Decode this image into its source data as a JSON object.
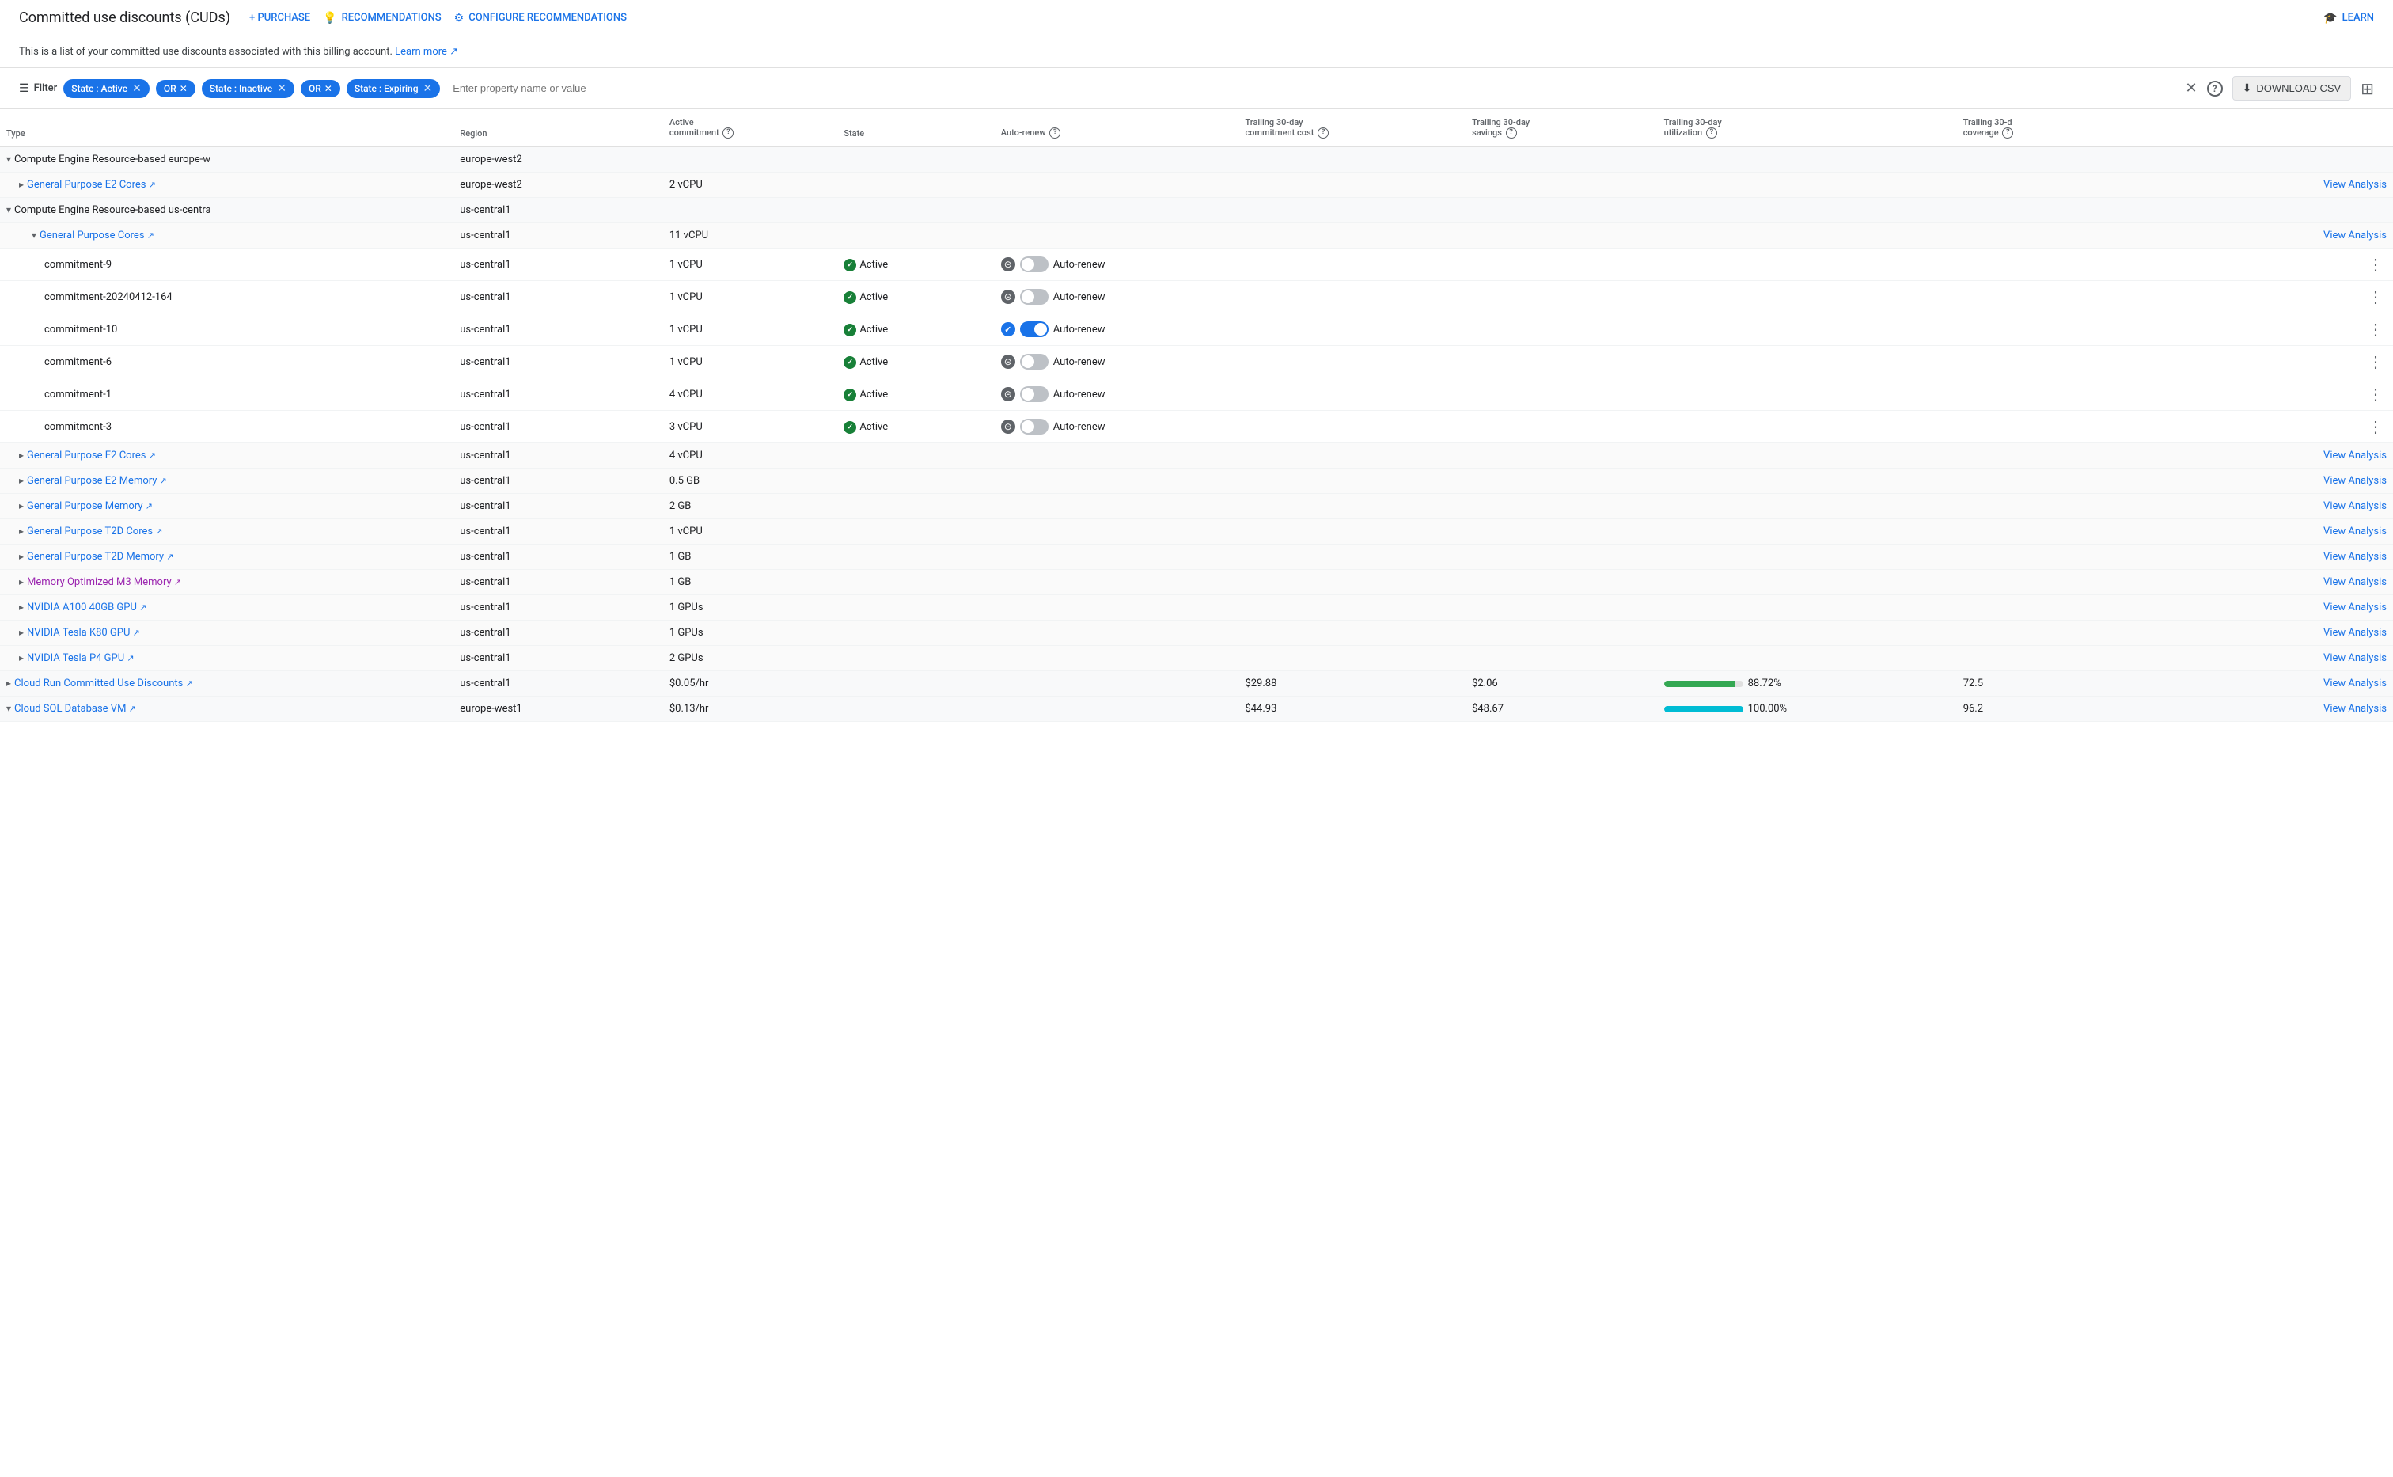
{
  "header": {
    "title": "Committed use discounts (CUDs)",
    "nav": [
      {
        "label": "+ PURCHASE",
        "icon": "+"
      },
      {
        "label": "💡 RECOMMENDATIONS",
        "icon": "💡"
      },
      {
        "label": "⚙ CONFIGURE RECOMMENDATIONS",
        "icon": "⚙"
      }
    ],
    "learn": "🎓 LEARN"
  },
  "description": {
    "text": "This is a list of your committed use discounts associated with this billing account.",
    "link_text": "Learn more ↗"
  },
  "filter": {
    "label": "Filter",
    "chips": [
      {
        "text": "State : Active",
        "type": "state"
      },
      {
        "text": "OR",
        "type": "or"
      },
      {
        "text": "State : Inactive",
        "type": "state"
      },
      {
        "text": "OR",
        "type": "or"
      },
      {
        "text": "State : Expiring",
        "type": "state"
      }
    ],
    "input_placeholder": "Enter property name or value",
    "download_label": "DOWNLOAD CSV",
    "columns_icon": "columns"
  },
  "table": {
    "headers": [
      {
        "label": "Type",
        "help": false
      },
      {
        "label": "Region",
        "help": false
      },
      {
        "label": "Active\ncommitment",
        "help": true
      },
      {
        "label": "State",
        "help": false
      },
      {
        "label": "Auto-renew",
        "help": true
      },
      {
        "label": "Trailing 30-day\ncommitment cost",
        "help": true
      },
      {
        "label": "Trailing 30-day\nsavings",
        "help": true
      },
      {
        "label": "Trailing 30-day\nutilization",
        "help": true
      },
      {
        "label": "Trailing 30-d\ncoverage",
        "help": true
      },
      {
        "label": "",
        "help": false
      }
    ],
    "rows": [
      {
        "id": "group-1",
        "type": "group-l1",
        "indent": 0,
        "expanded": true,
        "name": "Compute Engine Resource-based europe-w",
        "region": "europe-west2",
        "active_commitment": "",
        "state": "",
        "autorenew": null,
        "cost": "",
        "savings": "",
        "utilization": "",
        "utilization_pct": 0,
        "coverage": "",
        "coverage_pct": 0,
        "view_analysis": false,
        "three_dots": false
      },
      {
        "id": "item-1",
        "type": "group-l2",
        "indent": 1,
        "expanded": false,
        "name": "General Purpose E2 Cores",
        "link": true,
        "link_color": "blue",
        "region": "europe-west2",
        "active_commitment": "2 vCPU",
        "state": "",
        "autorenew": null,
        "cost": "",
        "savings": "",
        "utilization": "",
        "utilization_pct": 0,
        "coverage": "",
        "coverage_pct": 0,
        "view_analysis": true,
        "three_dots": false
      },
      {
        "id": "group-2",
        "type": "group-l1",
        "indent": 0,
        "expanded": true,
        "name": "Compute Engine Resource-based us-centra",
        "region": "us-central1",
        "active_commitment": "",
        "state": "",
        "autorenew": null,
        "cost": "",
        "savings": "",
        "utilization": "",
        "utilization_pct": 0,
        "coverage": "",
        "coverage_pct": 0,
        "view_analysis": false,
        "three_dots": false
      },
      {
        "id": "item-2",
        "type": "group-l2",
        "indent": 2,
        "expanded": true,
        "name": "General Purpose Cores",
        "link": true,
        "link_color": "blue",
        "region": "us-central1",
        "active_commitment": "11 vCPU",
        "state": "",
        "autorenew": null,
        "cost": "",
        "savings": "",
        "utilization": "",
        "utilization_pct": 0,
        "coverage": "",
        "coverage_pct": 0,
        "view_analysis": true,
        "three_dots": false
      },
      {
        "id": "leaf-1",
        "type": "leaf",
        "indent": 3,
        "name": "commitment-9",
        "region": "us-central1",
        "active_commitment": "1 vCPU",
        "state": "Active",
        "autorenew": false,
        "cost": "",
        "savings": "",
        "utilization": "",
        "utilization_pct": 0,
        "coverage": "",
        "coverage_pct": 0,
        "view_analysis": false,
        "three_dots": true
      },
      {
        "id": "leaf-2",
        "type": "leaf",
        "indent": 3,
        "name": "commitment-20240412-164",
        "region": "us-central1",
        "active_commitment": "1 vCPU",
        "state": "Active",
        "autorenew": false,
        "cost": "",
        "savings": "",
        "utilization": "",
        "utilization_pct": 0,
        "coverage": "",
        "coverage_pct": 0,
        "view_analysis": false,
        "three_dots": true
      },
      {
        "id": "leaf-3",
        "type": "leaf",
        "indent": 3,
        "name": "commitment-10",
        "region": "us-central1",
        "active_commitment": "1 vCPU",
        "state": "Active",
        "autorenew": true,
        "cost": "",
        "savings": "",
        "utilization": "",
        "utilization_pct": 0,
        "coverage": "",
        "coverage_pct": 0,
        "view_analysis": false,
        "three_dots": true
      },
      {
        "id": "leaf-4",
        "type": "leaf",
        "indent": 3,
        "name": "commitment-6",
        "region": "us-central1",
        "active_commitment": "1 vCPU",
        "state": "Active",
        "autorenew": false,
        "cost": "",
        "savings": "",
        "utilization": "",
        "utilization_pct": 0,
        "coverage": "",
        "coverage_pct": 0,
        "view_analysis": false,
        "three_dots": true
      },
      {
        "id": "leaf-5",
        "type": "leaf",
        "indent": 3,
        "name": "commitment-1",
        "region": "us-central1",
        "active_commitment": "4 vCPU",
        "state": "Active",
        "autorenew": false,
        "cost": "",
        "savings": "",
        "utilization": "",
        "utilization_pct": 0,
        "coverage": "",
        "coverage_pct": 0,
        "view_analysis": false,
        "three_dots": true
      },
      {
        "id": "leaf-6",
        "type": "leaf",
        "indent": 3,
        "name": "commitment-3",
        "region": "us-central1",
        "active_commitment": "3 vCPU",
        "state": "Active",
        "autorenew": false,
        "cost": "",
        "savings": "",
        "utilization": "",
        "utilization_pct": 0,
        "coverage": "",
        "coverage_pct": 0,
        "view_analysis": false,
        "three_dots": true
      },
      {
        "id": "item-3",
        "type": "group-l2",
        "indent": 1,
        "expanded": false,
        "name": "General Purpose E2 Cores",
        "link": true,
        "link_color": "blue",
        "region": "us-central1",
        "active_commitment": "4 vCPU",
        "state": "",
        "autorenew": null,
        "cost": "",
        "savings": "",
        "utilization": "",
        "utilization_pct": 0,
        "coverage": "",
        "coverage_pct": 0,
        "view_analysis": true,
        "three_dots": false
      },
      {
        "id": "item-4",
        "type": "group-l2",
        "indent": 1,
        "expanded": false,
        "name": "General Purpose E2 Memory",
        "link": true,
        "link_color": "blue",
        "region": "us-central1",
        "active_commitment": "0.5 GB",
        "state": "",
        "autorenew": null,
        "cost": "",
        "savings": "",
        "utilization": "",
        "utilization_pct": 0,
        "coverage": "",
        "coverage_pct": 0,
        "view_analysis": true,
        "three_dots": false
      },
      {
        "id": "item-5",
        "type": "group-l2",
        "indent": 1,
        "expanded": false,
        "name": "General Purpose Memory",
        "link": true,
        "link_color": "blue",
        "region": "us-central1",
        "active_commitment": "2 GB",
        "state": "",
        "autorenew": null,
        "cost": "",
        "savings": "",
        "utilization": "",
        "utilization_pct": 0,
        "coverage": "",
        "coverage_pct": 0,
        "view_analysis": true,
        "three_dots": false
      },
      {
        "id": "item-6",
        "type": "group-l2",
        "indent": 1,
        "expanded": false,
        "name": "General Purpose T2D Cores",
        "link": true,
        "link_color": "blue",
        "region": "us-central1",
        "active_commitment": "1 vCPU",
        "state": "",
        "autorenew": null,
        "cost": "",
        "savings": "",
        "utilization": "",
        "utilization_pct": 0,
        "coverage": "",
        "coverage_pct": 0,
        "view_analysis": true,
        "three_dots": false
      },
      {
        "id": "item-7",
        "type": "group-l2",
        "indent": 1,
        "expanded": false,
        "name": "General Purpose T2D Memory",
        "link": true,
        "link_color": "blue",
        "region": "us-central1",
        "active_commitment": "1 GB",
        "state": "",
        "autorenew": null,
        "cost": "",
        "savings": "",
        "utilization": "",
        "utilization_pct": 0,
        "coverage": "",
        "coverage_pct": 0,
        "view_analysis": true,
        "three_dots": false
      },
      {
        "id": "item-8",
        "type": "group-l2",
        "indent": 1,
        "expanded": false,
        "name": "Memory Optimized M3 Memory",
        "link": true,
        "link_color": "purple",
        "region": "us-central1",
        "active_commitment": "1 GB",
        "state": "",
        "autorenew": null,
        "cost": "",
        "savings": "",
        "utilization": "",
        "utilization_pct": 0,
        "coverage": "",
        "coverage_pct": 0,
        "view_analysis": true,
        "three_dots": false
      },
      {
        "id": "item-9",
        "type": "group-l2",
        "indent": 1,
        "expanded": false,
        "name": "NVIDIA A100 40GB GPU",
        "link": true,
        "link_color": "blue",
        "region": "us-central1",
        "active_commitment": "1 GPUs",
        "state": "",
        "autorenew": null,
        "cost": "",
        "savings": "",
        "utilization": "",
        "utilization_pct": 0,
        "coverage": "",
        "coverage_pct": 0,
        "view_analysis": true,
        "three_dots": false
      },
      {
        "id": "item-10",
        "type": "group-l2",
        "indent": 1,
        "expanded": false,
        "name": "NVIDIA Tesla K80 GPU",
        "link": true,
        "link_color": "blue",
        "region": "us-central1",
        "active_commitment": "1 GPUs",
        "state": "",
        "autorenew": null,
        "cost": "",
        "savings": "",
        "utilization": "",
        "utilization_pct": 0,
        "coverage": "",
        "coverage_pct": 0,
        "view_analysis": true,
        "three_dots": false
      },
      {
        "id": "item-11",
        "type": "group-l2",
        "indent": 1,
        "expanded": false,
        "name": "NVIDIA Tesla P4 GPU",
        "link": true,
        "link_color": "blue",
        "region": "us-central1",
        "active_commitment": "2 GPUs",
        "state": "",
        "autorenew": null,
        "cost": "",
        "savings": "",
        "utilization": "",
        "utilization_pct": 0,
        "coverage": "",
        "coverage_pct": 0,
        "view_analysis": true,
        "three_dots": false
      },
      {
        "id": "group-3",
        "type": "group-l1",
        "indent": 0,
        "expanded": false,
        "name": "Cloud Run Committed Use Discounts",
        "link": true,
        "link_color": "blue",
        "region": "us-central1",
        "active_commitment": "$0.05/hr",
        "state": "",
        "autorenew": null,
        "cost": "$29.88",
        "savings": "$2.06",
        "utilization": "88.72%",
        "utilization_pct": 89,
        "utilization_color": "green",
        "coverage": "72.5",
        "coverage_pct": 72,
        "view_analysis": true,
        "three_dots": false
      },
      {
        "id": "group-4",
        "type": "group-l1",
        "indent": 0,
        "expanded": true,
        "name": "Cloud SQL Database VM",
        "link": true,
        "link_color": "blue",
        "region": "europe-west1",
        "active_commitment": "$0.13/hr",
        "state": "",
        "autorenew": null,
        "cost": "$44.93",
        "savings": "$48.67",
        "utilization": "100.00%",
        "utilization_pct": 100,
        "utilization_color": "teal",
        "coverage": "96.2",
        "coverage_pct": 96,
        "view_analysis": true,
        "three_dots": false
      }
    ],
    "view_analysis_label": "View Analysis",
    "auto_renew_label": "Auto-renew"
  }
}
